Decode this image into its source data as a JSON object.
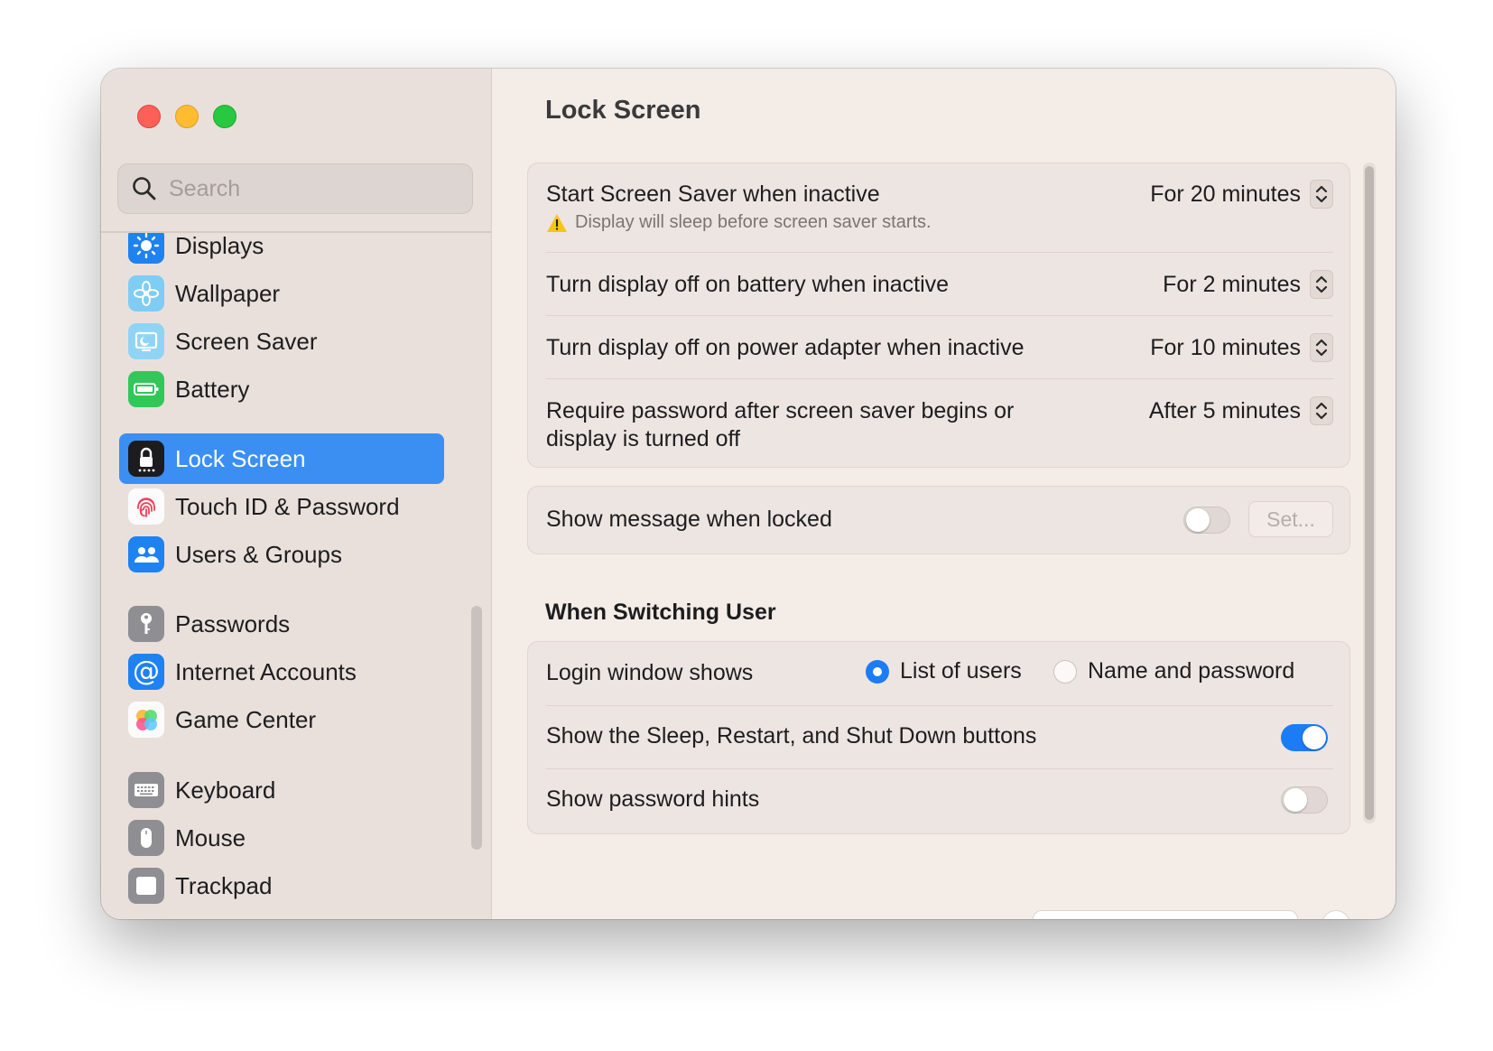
{
  "sidebar": {
    "search_placeholder": "Search",
    "items": [
      {
        "label": "Displays",
        "icon": "displays-icon"
      },
      {
        "label": "Wallpaper",
        "icon": "wallpaper-icon"
      },
      {
        "label": "Screen Saver",
        "icon": "screen-saver-icon"
      },
      {
        "label": "Battery",
        "icon": "battery-icon"
      },
      {
        "label": "Lock Screen",
        "icon": "lock-icon",
        "selected": true
      },
      {
        "label": "Touch ID & Password",
        "icon": "fingerprint-icon"
      },
      {
        "label": "Users & Groups",
        "icon": "users-icon"
      },
      {
        "label": "Passwords",
        "icon": "key-icon"
      },
      {
        "label": "Internet Accounts",
        "icon": "at-icon"
      },
      {
        "label": "Game Center",
        "icon": "game-center-icon"
      },
      {
        "label": "Keyboard",
        "icon": "keyboard-icon"
      },
      {
        "label": "Mouse",
        "icon": "mouse-icon"
      },
      {
        "label": "Trackpad",
        "icon": "trackpad-icon"
      }
    ]
  },
  "main": {
    "title": "Lock Screen",
    "screen_saver": {
      "label": "Start Screen Saver when inactive",
      "value": "For 20 minutes",
      "warning": "Display will sleep before screen saver starts."
    },
    "battery_off": {
      "label": "Turn display off on battery when inactive",
      "value": "For 2 minutes"
    },
    "adapter_off": {
      "label": "Turn display off on power adapter when inactive",
      "value": "For 10 minutes"
    },
    "require_password": {
      "label_line1": "Require password after screen saver begins or",
      "label_line2": "display is turned off",
      "value": "After 5 minutes"
    },
    "show_message": {
      "label": "Show message when locked",
      "enabled": false,
      "button": "Set..."
    },
    "switching": {
      "title": "When Switching User",
      "login_window": {
        "label": "Login window shows",
        "options": [
          "List of users",
          "Name and password"
        ],
        "selected": "List of users"
      },
      "sleep_buttons": {
        "label": "Show the Sleep, Restart, and Shut Down buttons",
        "enabled": true
      },
      "password_hints": {
        "label": "Show password hints",
        "enabled": false
      }
    }
  },
  "colors": {
    "accent": "#1b7cf5",
    "selection": "#3b8ff3",
    "close": "#fe5f57",
    "minimize": "#febc2e",
    "zoom": "#28c840"
  }
}
